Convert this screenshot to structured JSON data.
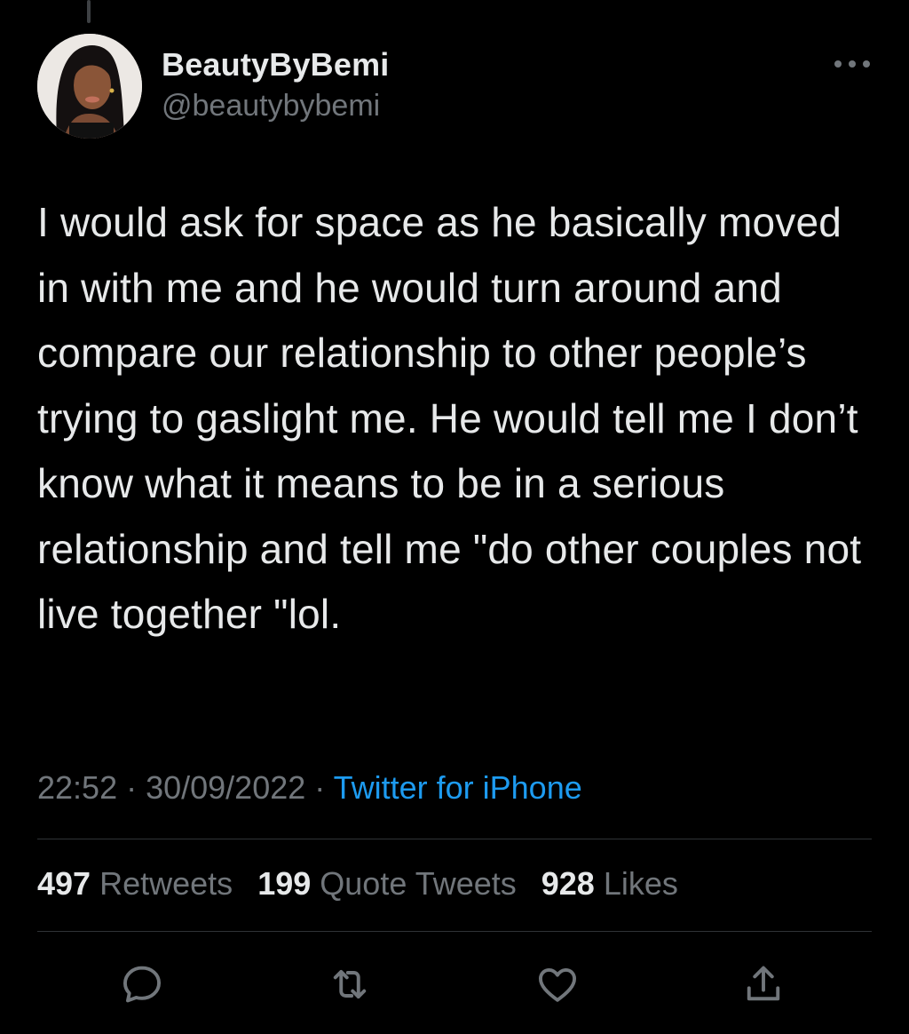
{
  "author": {
    "display_name": "BeautyByBemi",
    "handle": "@beautybybemi",
    "avatar_icon": "avatar"
  },
  "tweet": {
    "text": "I would ask for space as he basically moved in with me and he would turn around and compare our relationship to other people’s trying to gaslight me. He would tell me I don’t know what it means to be in a serious relationship and tell me \"do other couples not live together \"lol."
  },
  "meta": {
    "time": "22:52",
    "separator": " · ",
    "date": "30/09/2022",
    "source": "Twitter for iPhone"
  },
  "stats": {
    "retweets_count": "497",
    "retweets_label": "Retweets",
    "quotes_count": "199",
    "quotes_label": "Quote Tweets",
    "likes_count": "928",
    "likes_label": "Likes"
  },
  "actions": [
    {
      "icon": "reply-icon"
    },
    {
      "icon": "retweet-icon"
    },
    {
      "icon": "like-icon"
    },
    {
      "icon": "share-icon"
    }
  ],
  "colors": {
    "background": "#000000",
    "text_primary": "#e7e9ea",
    "text_secondary": "#71767b",
    "accent": "#1d9bf0",
    "divider": "#2f3336"
  }
}
